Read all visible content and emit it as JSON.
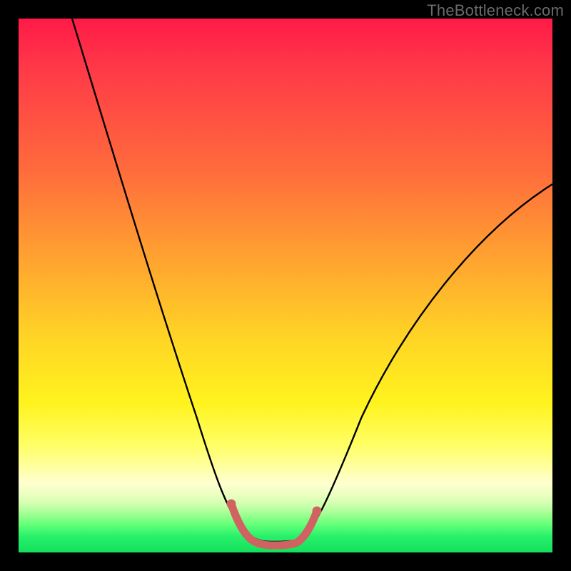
{
  "watermark": "TheBottleneck.com",
  "colors": {
    "page_bg": "#000000",
    "curve": "#000000",
    "accent_marker": "#d06262",
    "gradient_top": "#ff1a47",
    "gradient_bottom": "#14e05d"
  },
  "chart_data": {
    "type": "line",
    "title": "",
    "xlabel": "",
    "ylabel": "",
    "xlim": [
      0,
      100
    ],
    "ylim": [
      0,
      100
    ],
    "grid": false,
    "legend": false,
    "series": [
      {
        "name": "bottleneck-curve",
        "color": "#000000",
        "x": [
          10,
          14,
          18,
          22,
          26,
          30,
          33,
          36,
          38,
          40,
          41,
          42,
          43,
          44,
          46,
          48,
          50,
          52,
          54,
          56,
          60,
          65,
          70,
          75,
          80,
          85,
          90,
          95,
          100
        ],
        "values": [
          100,
          89,
          78,
          67,
          56,
          45,
          35,
          25,
          16,
          9,
          5,
          3,
          2,
          2,
          2,
          2,
          2,
          3,
          5,
          9,
          18,
          28,
          37,
          44,
          50,
          56,
          61,
          65,
          69
        ]
      },
      {
        "name": "optimal-range-marker",
        "color": "#d06262",
        "x": [
          40,
          41,
          42,
          43,
          44,
          46,
          48,
          50,
          52,
          54
        ],
        "values": [
          9,
          5,
          3,
          2,
          2,
          2,
          2,
          2,
          3,
          5
        ]
      }
    ]
  }
}
